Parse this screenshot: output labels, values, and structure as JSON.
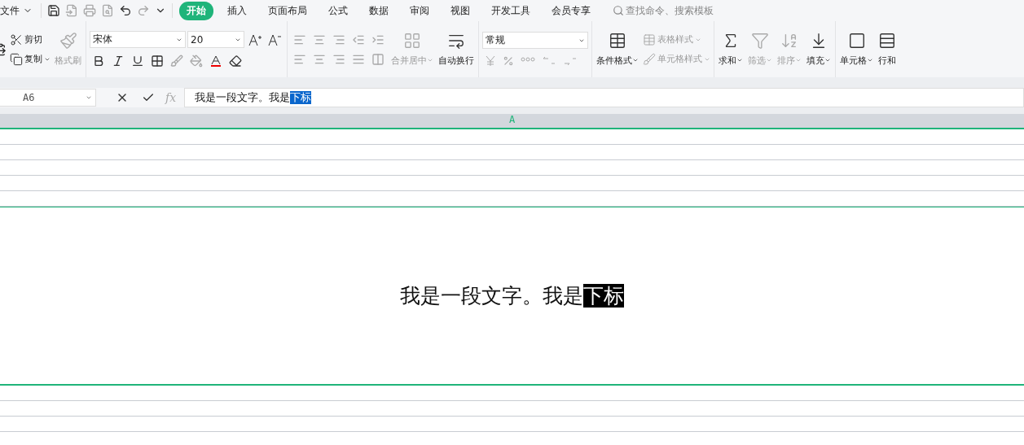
{
  "menu": {
    "file": "文件",
    "tabs": [
      {
        "label": "开始",
        "selected": true
      },
      {
        "label": "插入",
        "selected": false
      },
      {
        "label": "页面布局",
        "selected": false
      },
      {
        "label": "公式",
        "selected": false
      },
      {
        "label": "数据",
        "selected": false
      },
      {
        "label": "审阅",
        "selected": false
      },
      {
        "label": "视图",
        "selected": false
      },
      {
        "label": "开发工具",
        "selected": false
      },
      {
        "label": "会员专享",
        "selected": false
      }
    ],
    "search": {
      "placeholder": "查找命令、搜索模板"
    }
  },
  "ribbon": {
    "clipboard": {
      "cut": "剪切",
      "copy": "复制",
      "painter": {
        "label": "格式刷",
        "disabled": true
      }
    },
    "font": {
      "name": "宋体",
      "size": "20"
    },
    "alignment": {
      "merge": {
        "label": "合并居中",
        "disabled": true
      },
      "wrap": {
        "label": "自动换行",
        "disabled": false
      }
    },
    "number": {
      "format": "常规"
    },
    "styles": {
      "conditional": {
        "label": "条件格式",
        "disabled": false
      },
      "table_style": {
        "label": "表格样式",
        "disabled": true
      },
      "cell_style": {
        "label": "单元格样式",
        "disabled": true
      }
    },
    "editing": [
      {
        "label": "求和",
        "kind": "sum",
        "disabled": false
      },
      {
        "label": "筛选",
        "kind": "filter",
        "disabled": true
      },
      {
        "label": "排序",
        "kind": "sort",
        "disabled": true
      },
      {
        "label": "填充",
        "kind": "fill",
        "disabled": false
      }
    ],
    "cells": [
      {
        "label": "单元格",
        "kind": "cell"
      },
      {
        "label": "行和",
        "kind": "rowcol"
      }
    ]
  },
  "formula_bar": {
    "cell_ref": "A6",
    "fx": "fx",
    "text": "我是一段文字。我是",
    "selection": "下标"
  },
  "sheet": {
    "column": "A",
    "rows": [
      {
        "kind": "blank",
        "selected": false
      },
      {
        "kind": "blank",
        "selected": false
      },
      {
        "kind": "blank",
        "selected": false
      },
      {
        "kind": "blank",
        "selected": false
      },
      {
        "kind": "blank",
        "selected": false
      },
      {
        "kind": "edit",
        "selected": true,
        "text": "我是一段文字。我是",
        "selection": "下标"
      },
      {
        "kind": "blank",
        "selected": false
      },
      {
        "kind": "blank",
        "selected": false
      },
      {
        "kind": "blank",
        "selected": false
      }
    ]
  }
}
